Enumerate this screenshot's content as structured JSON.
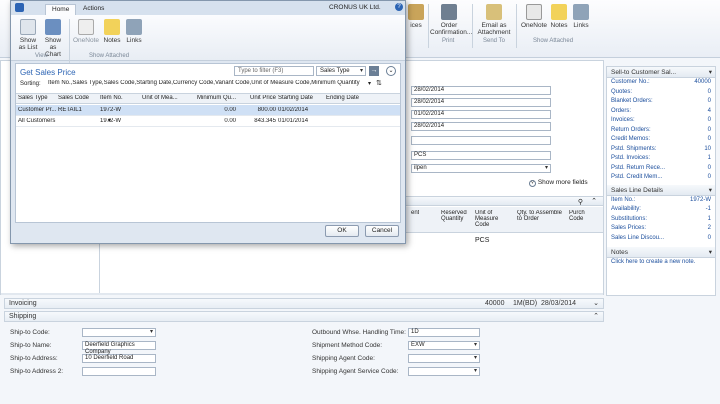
{
  "bg_ribbon": {
    "buttons": [
      {
        "label": "ices"
      },
      {
        "label": "Order Confirmation..."
      },
      {
        "label": "Email as Attachment"
      },
      {
        "label": "OneNote"
      },
      {
        "label": "Notes"
      },
      {
        "label": "Links"
      }
    ],
    "groups": {
      "print": "Print",
      "send_to": "Send To",
      "show_attached": "Show Attached"
    }
  },
  "bg_form": {
    "dates": [
      "28/02/2014",
      "28/02/2014",
      "01/02/2014",
      "28/02/2014"
    ],
    "unit": "PCS",
    "shipment": "ilpen",
    "show_more": "Show more fields"
  },
  "bg_lines": {
    "headers": [
      "ent",
      "Reserved Quantity",
      "Unit of Measure Code",
      "Qty. to Assemble to Order",
      "Purch Code"
    ],
    "row_unit": "PCS"
  },
  "factbox": {
    "customer_title": "Sell-to Customer Sal...",
    "customer_rows": [
      {
        "k": "Customer No.:",
        "v": "40000"
      },
      {
        "k": "Quotes:",
        "v": "0"
      },
      {
        "k": "Blanket Orders:",
        "v": "0"
      },
      {
        "k": "Orders:",
        "v": "4"
      },
      {
        "k": "Invoices:",
        "v": "0"
      },
      {
        "k": "Return Orders:",
        "v": "0"
      },
      {
        "k": "Credit Memos:",
        "v": "0"
      },
      {
        "k": "Pstd. Shipments:",
        "v": "10"
      },
      {
        "k": "Pstd. Invoices:",
        "v": "1"
      },
      {
        "k": "Pstd. Return Rece...",
        "v": "0"
      },
      {
        "k": "Pstd. Credit Mem...",
        "v": "0"
      }
    ],
    "line_title": "Sales Line Details",
    "line_rows": [
      {
        "k": "Item No.:",
        "v": "1972-W"
      },
      {
        "k": "Availability:",
        "v": "-1"
      },
      {
        "k": "Substitutions:",
        "v": "1"
      },
      {
        "k": "Sales Prices:",
        "v": "2"
      },
      {
        "k": "Sales Line Discou...",
        "v": "0"
      }
    ],
    "notes_title": "Notes",
    "notes_link": "Click here to create a new note."
  },
  "invoicing": {
    "label": "Invoicing",
    "summary": [
      "40000",
      "1M(BD)",
      "28/03/2014"
    ]
  },
  "shipping": {
    "label": "Shipping",
    "left": [
      {
        "label": "Ship-to Code:",
        "value": ""
      },
      {
        "label": "Ship-to Name:",
        "value": "Deerfield Graphics Company"
      },
      {
        "label": "Ship-to Address:",
        "value": "10 Deerfield Road"
      },
      {
        "label": "Ship-to Address 2:",
        "value": ""
      }
    ],
    "right": [
      {
        "label": "Outbound Whse. Handling Time:",
        "value": "1D"
      },
      {
        "label": "Shipment Method Code:",
        "value": "EXW"
      },
      {
        "label": "Shipping Agent Code:",
        "value": ""
      },
      {
        "label": "Shipping Agent Service Code:",
        "value": ""
      }
    ]
  },
  "dialog": {
    "app_title": "CRONUS UK Ltd.",
    "tabs": {
      "home": "Home",
      "actions": "Actions"
    },
    "ribbon": {
      "show_as_list": "Show as List",
      "show_as_chart": "Show as Chart",
      "onenote": "OneNote",
      "notes": "Notes",
      "links": "Links",
      "group_view": "View",
      "group_show_attached": "Show Attached"
    },
    "page_title": "Get Sales Price",
    "filter_placeholder": "Type to filter (F3)",
    "filter_field": "Sales Type",
    "sorting_label": "Sorting:",
    "sorting_value": "Item No.,Sales Type,Sales Code,Starting Date,Currency Code,Variant Code,Unit of Measure Code,Minimum Quantity",
    "columns": [
      "Sales Type",
      "Sales Code",
      "Item No.",
      "Unit of Mea...",
      "Minimum Qu...",
      "Unit Price",
      "Starting Date",
      "Ending Date"
    ],
    "rows": [
      [
        "Customer Pr...",
        "RETAIL1",
        "1972-W",
        "",
        "0.00",
        "800.00",
        "01/02/2014",
        ""
      ],
      [
        "All Customers",
        "",
        "1972-W",
        "",
        "0.00",
        "843.345",
        "01/01/2014",
        ""
      ]
    ],
    "ok": "OK",
    "cancel": "Cancel"
  }
}
